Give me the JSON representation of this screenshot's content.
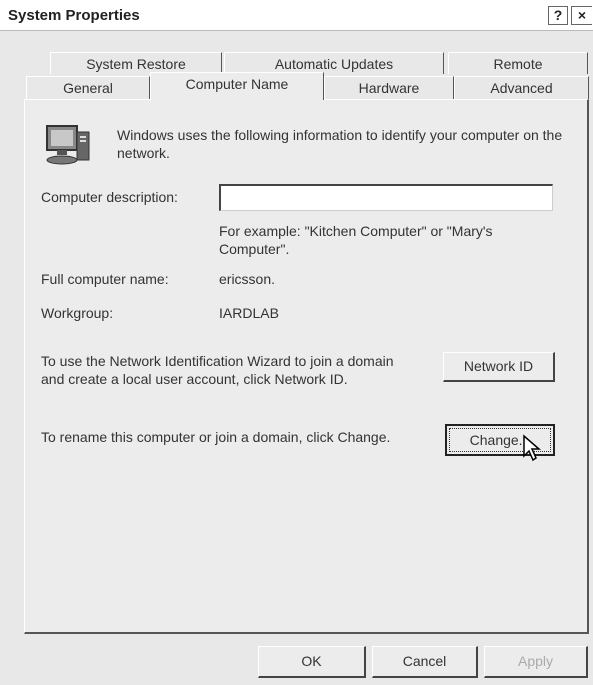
{
  "window": {
    "title": "System Properties",
    "help_label": "?",
    "close_label": "×"
  },
  "tabs_row1": [
    {
      "label": "System Restore"
    },
    {
      "label": "Automatic Updates"
    },
    {
      "label": "Remote"
    }
  ],
  "tabs_row2": [
    {
      "label": "General"
    },
    {
      "label": "Computer Name"
    },
    {
      "label": "Hardware"
    },
    {
      "label": "Advanced"
    }
  ],
  "active_tab": "Computer Name",
  "content": {
    "intro_text": "Windows uses the following information to identify your computer on the network.",
    "intro_icon": "computer-icon",
    "description_label": "Computer description:",
    "description_value": "",
    "example_text": "For example: \"Kitchen Computer\" or \"Mary's Computer\".",
    "full_name_label": "Full computer name:",
    "full_name_value": "ericsson.",
    "workgroup_label": "Workgroup:",
    "workgroup_value": "IARDLAB",
    "network_id_text": "To use the Network Identification Wizard to join a domain and create a local user account, click Network ID.",
    "network_id_button": "Network ID",
    "change_text": "To rename this computer or join a domain, click Change.",
    "change_button": "Change..."
  },
  "footer": {
    "ok_label": "OK",
    "cancel_label": "Cancel",
    "apply_label": "Apply"
  }
}
